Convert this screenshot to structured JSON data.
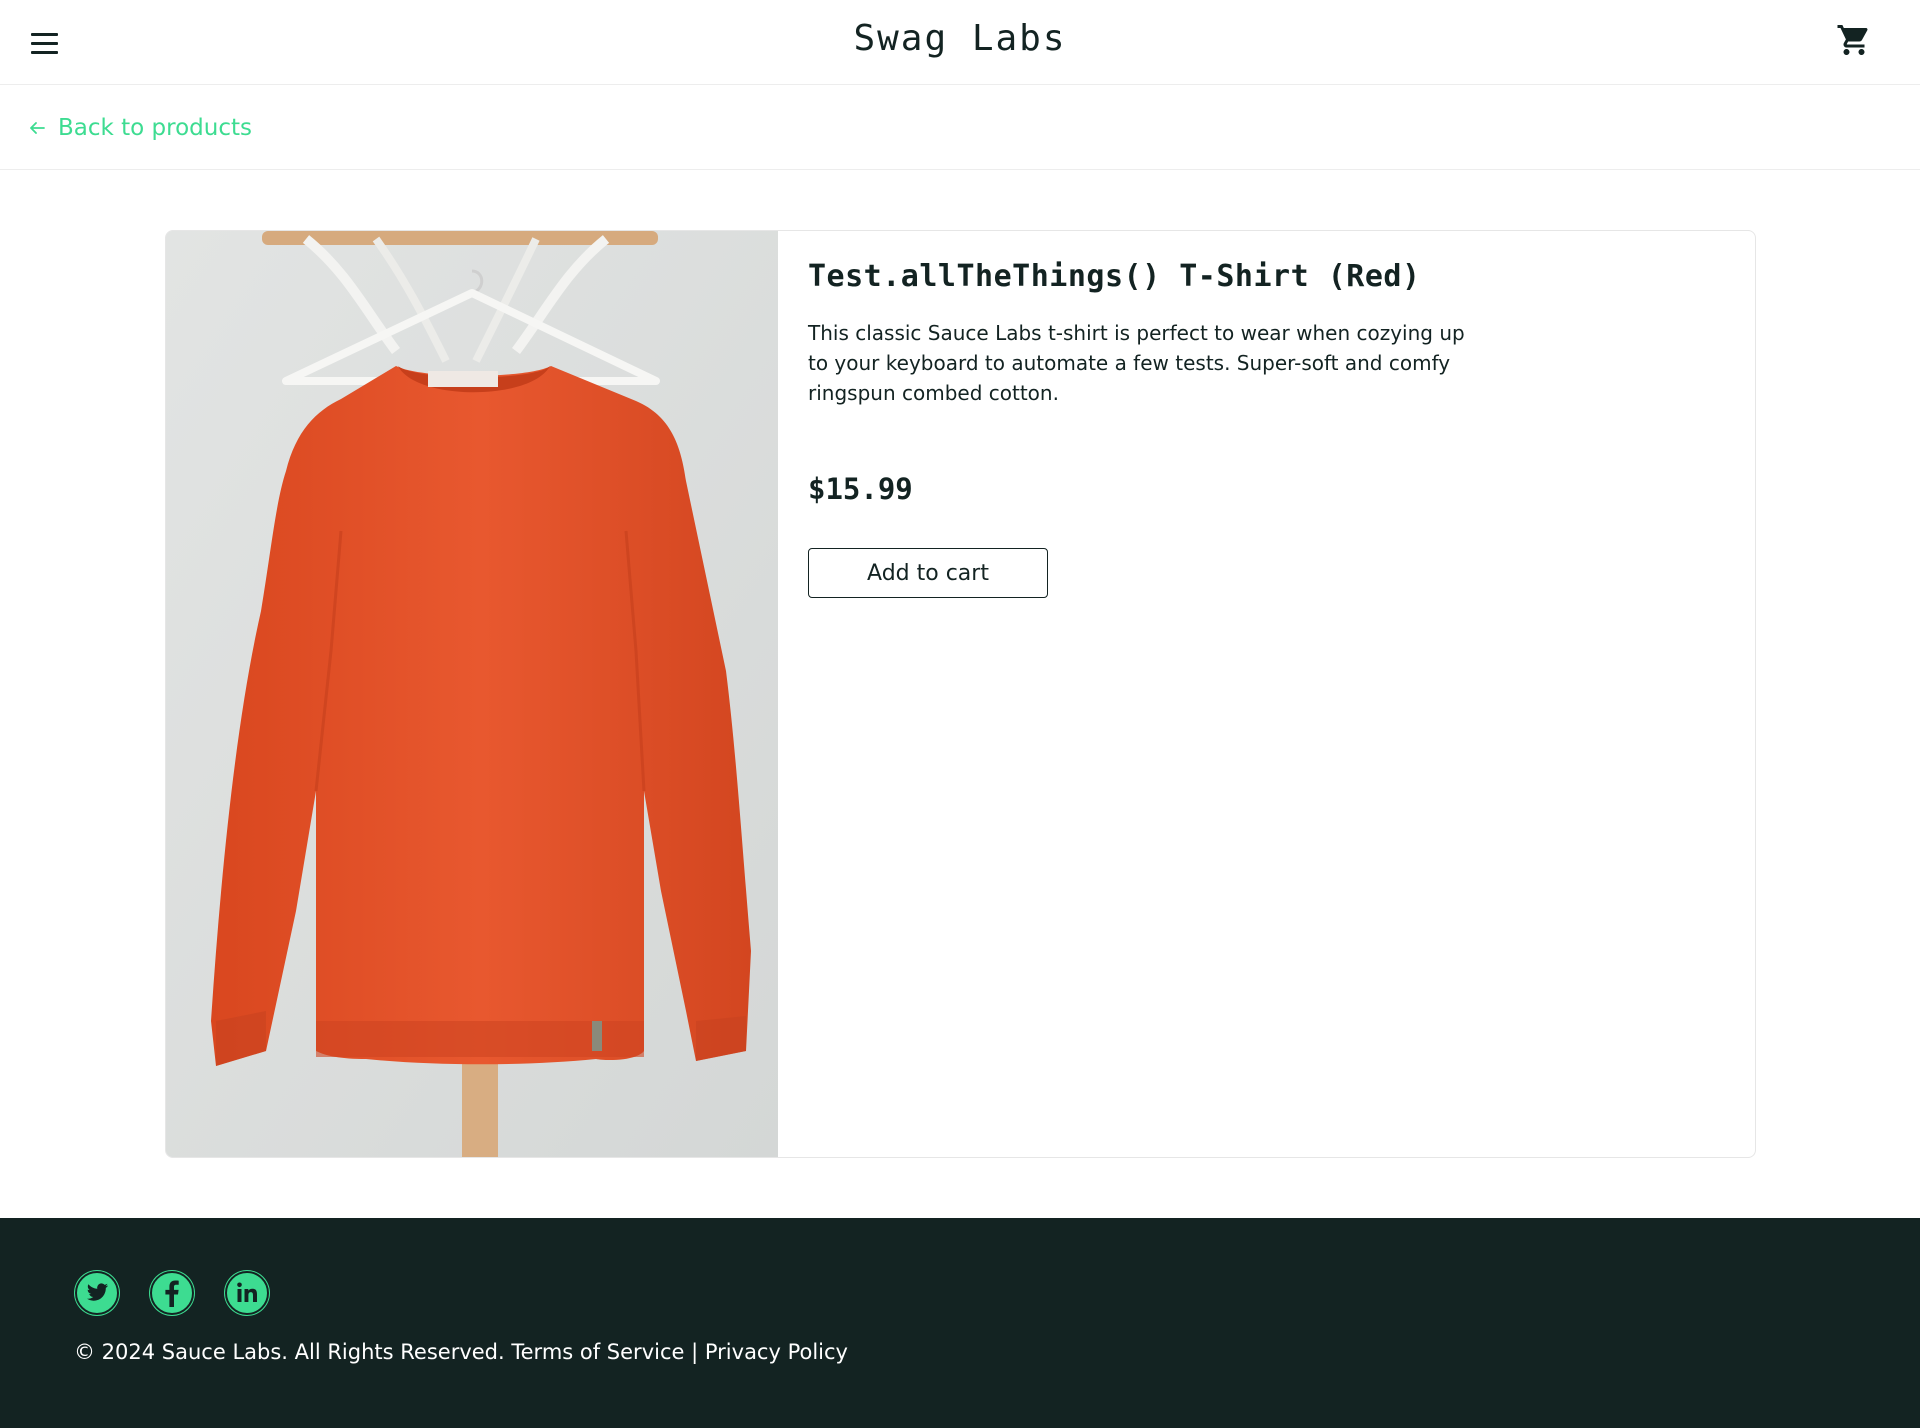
{
  "header": {
    "app_title": "Swag Labs",
    "menu_icon": "hamburger-menu-icon",
    "cart_icon": "shopping-cart-icon"
  },
  "subbar": {
    "back_label": "Back to products",
    "back_icon": "arrow-left-icon"
  },
  "product": {
    "name": "Test.allTheThings() T-Shirt (Red)",
    "description": "This classic Sauce Labs t-shirt is perfect to wear when cozying up to your keyboard to automate a few tests. Super-soft and comfy ringspun combed cotton.",
    "price": "$15.99",
    "add_to_cart_label": "Add to cart",
    "image": "orange-sweatshirt-on-hanger-photo"
  },
  "footer": {
    "social": [
      "twitter-icon",
      "facebook-icon",
      "linkedin-icon"
    ],
    "copyright": "© 2024 Sauce Labs. All Rights Reserved.",
    "terms": "Terms of Service",
    "separator": "|",
    "privacy": "Privacy Policy"
  },
  "colors": {
    "accent": "#3ddc91",
    "dark": "#132322",
    "shirt": "#e5532b",
    "background_image": "#dfe1e0"
  }
}
